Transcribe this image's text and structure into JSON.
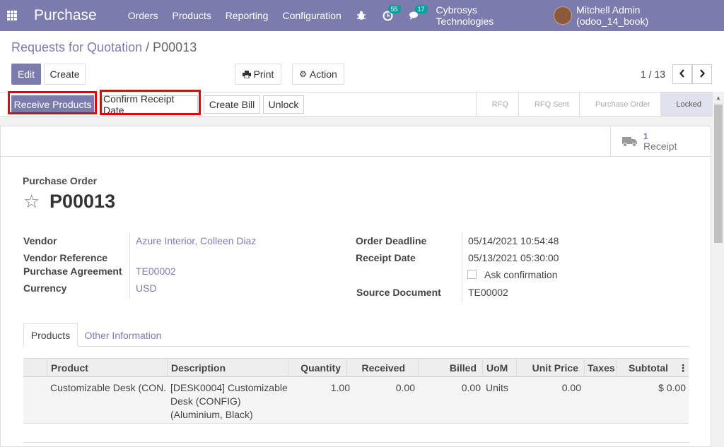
{
  "navbar": {
    "app_title": "Purchase",
    "menu": [
      "Orders",
      "Products",
      "Reporting",
      "Configuration"
    ],
    "activity_count": "55",
    "message_count": "17",
    "company": "Cybrosys Technologies",
    "user": "Mitchell Admin (odoo_14_book)"
  },
  "breadcrumb": {
    "parent": "Requests for Quotation",
    "separator": "/",
    "current": "P00013"
  },
  "control": {
    "edit_label": "Edit",
    "create_label": "Create",
    "print_label": "Print",
    "action_label": "Action",
    "pager": "1 / 13"
  },
  "statusbar": {
    "buttons": [
      "Receive Products",
      "Confirm Receipt Date",
      "Create Bill",
      "Unlock"
    ],
    "stages": [
      "RFQ",
      "RFQ Sent",
      "Purchase Order",
      "Locked"
    ],
    "active_stage": "Locked"
  },
  "smart_button": {
    "count": "1",
    "label": "Receipt"
  },
  "form": {
    "doc_type": "Purchase Order",
    "name": "P00013",
    "vendor_label": "Vendor",
    "vendor": "Azure Interior, Colleen Diaz",
    "vendor_ref_label": "Vendor Reference",
    "agreement_label": "Purchase Agreement",
    "agreement": "TE00002",
    "currency_label": "Currency",
    "currency": "USD",
    "deadline_label": "Order Deadline",
    "deadline": "05/14/2021 10:54:48",
    "receipt_label": "Receipt Date",
    "receipt": "05/13/2021 05:30:00",
    "ask_confirmation": "Ask confirmation",
    "source_label": "Source Document",
    "source": "TE00002"
  },
  "tabs": [
    "Products",
    "Other Information"
  ],
  "table": {
    "headers": [
      "Product",
      "Description",
      "Quantity",
      "Received",
      "Billed",
      "UoM",
      "Unit Price",
      "Taxes",
      "Subtotal"
    ],
    "rows": [
      {
        "product": "Customizable Desk (CON...",
        "description_1": "[DESK0004] Customizable",
        "description_2": "Desk (CONFIG)",
        "description_3": "(Aluminium, Black)",
        "quantity": "1.00",
        "received": "0.00",
        "billed": "0.00",
        "uom": "Units",
        "unit_price": "0.00",
        "taxes": "",
        "subtotal": "$ 0.00"
      }
    ]
  },
  "colors": {
    "brand": "#7c7bad",
    "highlight": "#e00000",
    "badge": "#00a09d"
  }
}
